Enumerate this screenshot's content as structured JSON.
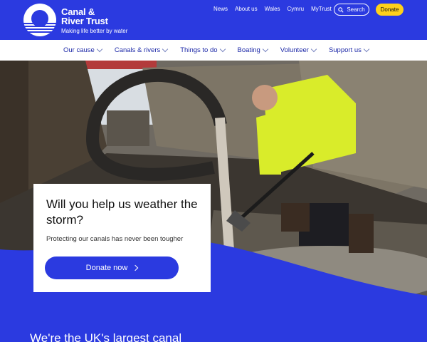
{
  "brand": {
    "name": "Canal & River Trust",
    "tagline": "Making life better by water"
  },
  "utility_nav": [
    "News",
    "About us",
    "Wales",
    "Cymru",
    "MyTrust"
  ],
  "search_label": "Search",
  "donate_label": "Donate",
  "main_nav": [
    "Our cause",
    "Canals & rivers",
    "Things to do",
    "Boating",
    "Volunteer",
    "Support us"
  ],
  "hero": {
    "title": "Will you help us weather the storm?",
    "subtitle": "Protecting our canals has never been tougher",
    "cta": "Donate now"
  },
  "section_heading": "We're the UK's largest canal",
  "colors": {
    "brand_blue": "#2b3ae0",
    "donate_yellow": "#ffd11a",
    "nav_text": "#1e2aa8"
  },
  "icons": [
    "logo-mark",
    "search-icon",
    "chevron-down-icon",
    "arrow-right-icon"
  ]
}
